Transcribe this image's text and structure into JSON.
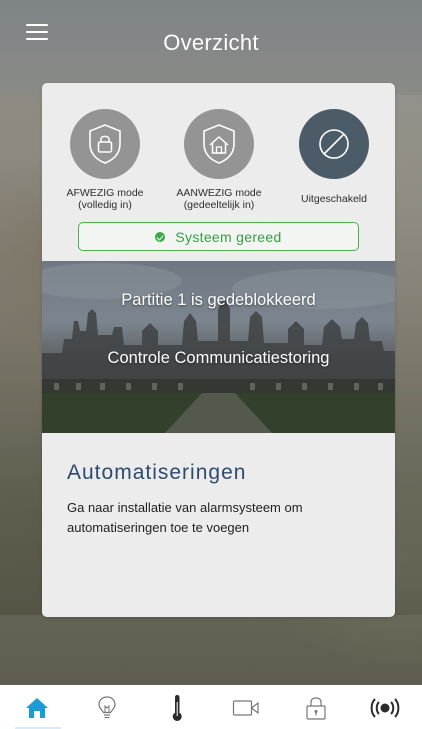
{
  "header": {
    "title": "Overzicht"
  },
  "modes": [
    {
      "line1": "AFWEZIG mode",
      "line2": "(volledig in)",
      "icon": "shield-lock-icon",
      "active": false
    },
    {
      "line1": "AANWEZIG mode",
      "line2": "(gedeeltelijk in)",
      "icon": "shield-home-icon",
      "active": false
    },
    {
      "line1": "Uitgeschakeld",
      "line2": "",
      "icon": "disabled-icon",
      "active": true
    }
  ],
  "status": {
    "text": "Systeem gereed",
    "color": "#3a9c45"
  },
  "banner": {
    "line1": "Partitie 1 is gedeblokkeerd",
    "line2": "Controle Communicatiestoring"
  },
  "automations": {
    "title": "Automatiseringen",
    "description": "Ga naar installatie van alarmsysteem om automatiseringen toe te voegen"
  },
  "tabs": [
    {
      "icon": "home-icon",
      "active": true
    },
    {
      "icon": "lightbulb-icon",
      "active": false
    },
    {
      "icon": "thermometer-icon",
      "active": false
    },
    {
      "icon": "camera-icon",
      "active": false
    },
    {
      "icon": "lock-icon",
      "active": false
    },
    {
      "icon": "alarm-signal-icon",
      "active": false
    }
  ],
  "colors": {
    "accent": "#1e9ad6",
    "active_mode": "#4b5b68",
    "inactive_mode": "#949494",
    "title_blue": "#2f4a6e"
  }
}
